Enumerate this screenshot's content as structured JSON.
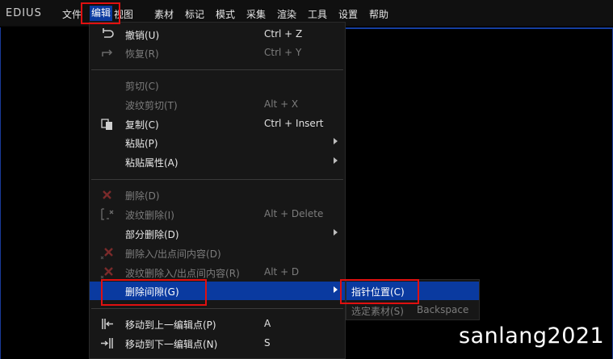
{
  "app": {
    "logo": "EDIUS"
  },
  "menubar": {
    "items": [
      "文件",
      "编辑",
      "视图",
      "素材",
      "标记",
      "模式",
      "采集",
      "渲染",
      "工具",
      "设置",
      "帮助"
    ],
    "active_index": 1
  },
  "edit_menu": {
    "items": [
      {
        "label": "撤销(U)",
        "shortcut": "Ctrl + Z",
        "disabled": false,
        "icon": "undo-icon"
      },
      {
        "label": "恢复(R)",
        "shortcut": "Ctrl + Y",
        "disabled": true,
        "icon": "redo-icon"
      },
      {
        "label": "剪切(C)",
        "shortcut": "",
        "disabled": true
      },
      {
        "label": "波纹剪切(T)",
        "shortcut": "Alt + X",
        "disabled": true
      },
      {
        "label": "复制(C)",
        "shortcut": "Ctrl + Insert",
        "disabled": false,
        "icon": "copy-icon"
      },
      {
        "label": "粘贴(P)",
        "shortcut": "",
        "disabled": false,
        "submenu": true
      },
      {
        "label": "粘贴属性(A)",
        "shortcut": "",
        "disabled": false,
        "submenu": true
      },
      {
        "label": "删除(D)",
        "shortcut": "",
        "disabled": true,
        "icon": "delete-icon"
      },
      {
        "label": "波纹删除(I)",
        "shortcut": "Alt + Delete",
        "disabled": true,
        "icon": "ripple-delete-icon"
      },
      {
        "label": "部分删除(D)",
        "shortcut": "",
        "disabled": false,
        "submenu": true
      },
      {
        "label": "删除入/出点间内容(D)",
        "shortcut": "",
        "disabled": true,
        "icon": "delete-in-out-icon"
      },
      {
        "label": "波纹删除入/出点间内容(R)",
        "shortcut": "Alt + D",
        "disabled": true,
        "icon": "ripple-delete-in-out-icon"
      },
      {
        "label": "删除间隙(G)",
        "shortcut": "",
        "disabled": false,
        "submenu": true,
        "highlight": true
      },
      {
        "label": "移动到上一编辑点(P)",
        "shortcut": "A",
        "disabled": false,
        "icon": "prev-edit-point-icon"
      },
      {
        "label": "移动到下一编辑点(N)",
        "shortcut": "S",
        "disabled": false,
        "icon": "next-edit-point-icon"
      }
    ]
  },
  "sub_menu": {
    "items": [
      {
        "label": "指针位置(C)",
        "shortcut": "",
        "highlight": true,
        "disabled": false
      },
      {
        "label": "选定素材(S)",
        "shortcut": "Backspace",
        "disabled": true
      }
    ]
  },
  "watermark": "sanlang2021",
  "colors": {
    "highlight": "#0a3aa0",
    "redbox": "#e01010",
    "disabled_text": "#7c7c7c"
  }
}
